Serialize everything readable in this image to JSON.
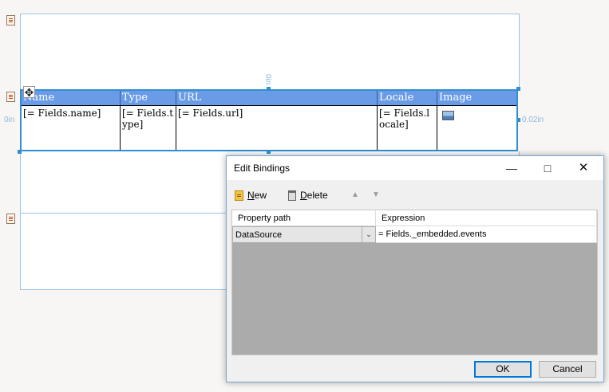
{
  "designer": {
    "rulers": {
      "top_margin": "0in",
      "left_margin": "0in",
      "right_margin": "0.02in"
    },
    "table": {
      "headers": [
        "Name",
        "Type",
        "URL",
        "Locale",
        "Image"
      ],
      "cells": [
        "[= Fields.name]",
        "[= Fields.type]",
        "[= Fields.url]",
        "[= Fields.locale]"
      ],
      "header_color": "#6a9be6",
      "selection_color": "#2f8fd0"
    }
  },
  "dialog": {
    "title": "Edit Bindings",
    "toolbar": {
      "new_label": "New",
      "delete_label": "Delete"
    },
    "grid": {
      "columns": [
        "Property path",
        "Expression"
      ],
      "rows": [
        {
          "property": "DataSource",
          "expression": "= Fields._embedded.events"
        }
      ]
    },
    "ok_label": "OK",
    "cancel_label": "Cancel"
  }
}
